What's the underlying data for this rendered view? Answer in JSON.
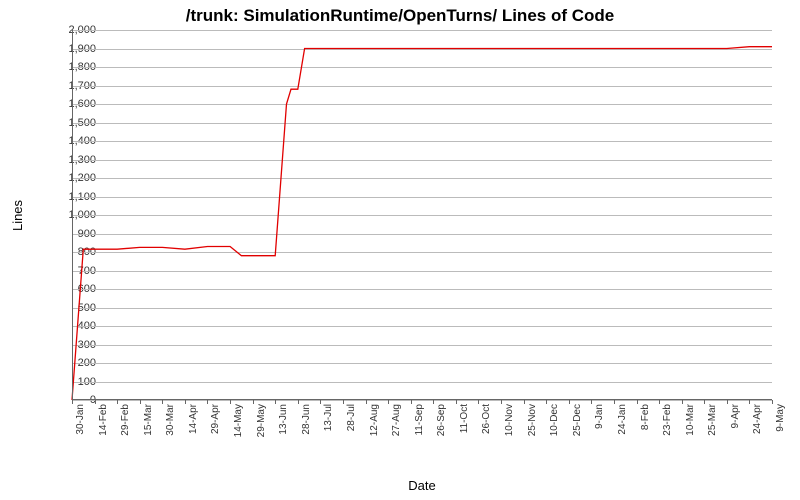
{
  "chart_data": {
    "type": "line",
    "title": "/trunk: SimulationRuntime/OpenTurns/ Lines of Code",
    "xlabel": "Date",
    "ylabel": "Lines",
    "ylim": [
      0,
      2000
    ],
    "y_ticks": [
      0,
      100,
      200,
      300,
      400,
      500,
      600,
      700,
      800,
      900,
      1000,
      1100,
      1200,
      1300,
      1400,
      1500,
      1600,
      1700,
      1800,
      1900,
      2000
    ],
    "y_tick_labels": [
      "0",
      "100",
      "200",
      "300",
      "400",
      "500",
      "600",
      "700",
      "800",
      "900",
      "1,000",
      "1,100",
      "1,200",
      "1,300",
      "1,400",
      "1,500",
      "1,600",
      "1,700",
      "1,800",
      "1,900",
      "2,000"
    ],
    "x_categories": [
      "30-Jan",
      "14-Feb",
      "29-Feb",
      "15-Mar",
      "30-Mar",
      "14-Apr",
      "29-Apr",
      "14-May",
      "29-May",
      "13-Jun",
      "28-Jun",
      "13-Jul",
      "28-Jul",
      "12-Aug",
      "27-Aug",
      "11-Sep",
      "26-Sep",
      "11-Oct",
      "26-Oct",
      "10-Nov",
      "25-Nov",
      "10-Dec",
      "25-Dec",
      "9-Jan",
      "24-Jan",
      "8-Feb",
      "23-Feb",
      "10-Mar",
      "25-Mar",
      "9-Apr",
      "24-Apr",
      "9-May"
    ],
    "series": [
      {
        "name": "Lines of Code",
        "color": "#e10000",
        "points": [
          {
            "x": 0,
            "y": 0
          },
          {
            "x": 0.5,
            "y": 815
          },
          {
            "x": 1,
            "y": 815
          },
          {
            "x": 2,
            "y": 815
          },
          {
            "x": 3,
            "y": 825
          },
          {
            "x": 4,
            "y": 825
          },
          {
            "x": 5,
            "y": 815
          },
          {
            "x": 6,
            "y": 830
          },
          {
            "x": 7,
            "y": 830
          },
          {
            "x": 7.5,
            "y": 780
          },
          {
            "x": 8,
            "y": 780
          },
          {
            "x": 9,
            "y": 780
          },
          {
            "x": 9.5,
            "y": 1600
          },
          {
            "x": 9.7,
            "y": 1680
          },
          {
            "x": 10,
            "y": 1680
          },
          {
            "x": 10.3,
            "y": 1900
          },
          {
            "x": 11,
            "y": 1900
          },
          {
            "x": 12,
            "y": 1900
          },
          {
            "x": 13,
            "y": 1900
          },
          {
            "x": 14,
            "y": 1900
          },
          {
            "x": 15,
            "y": 1900
          },
          {
            "x": 16,
            "y": 1900
          },
          {
            "x": 17,
            "y": 1900
          },
          {
            "x": 18,
            "y": 1900
          },
          {
            "x": 19,
            "y": 1900
          },
          {
            "x": 20,
            "y": 1900
          },
          {
            "x": 21,
            "y": 1900
          },
          {
            "x": 22,
            "y": 1900
          },
          {
            "x": 23,
            "y": 1900
          },
          {
            "x": 24,
            "y": 1900
          },
          {
            "x": 25,
            "y": 1900
          },
          {
            "x": 26,
            "y": 1900
          },
          {
            "x": 27,
            "y": 1900
          },
          {
            "x": 28,
            "y": 1900
          },
          {
            "x": 29,
            "y": 1900
          },
          {
            "x": 30,
            "y": 1910
          },
          {
            "x": 31,
            "y": 1910
          }
        ]
      }
    ]
  }
}
